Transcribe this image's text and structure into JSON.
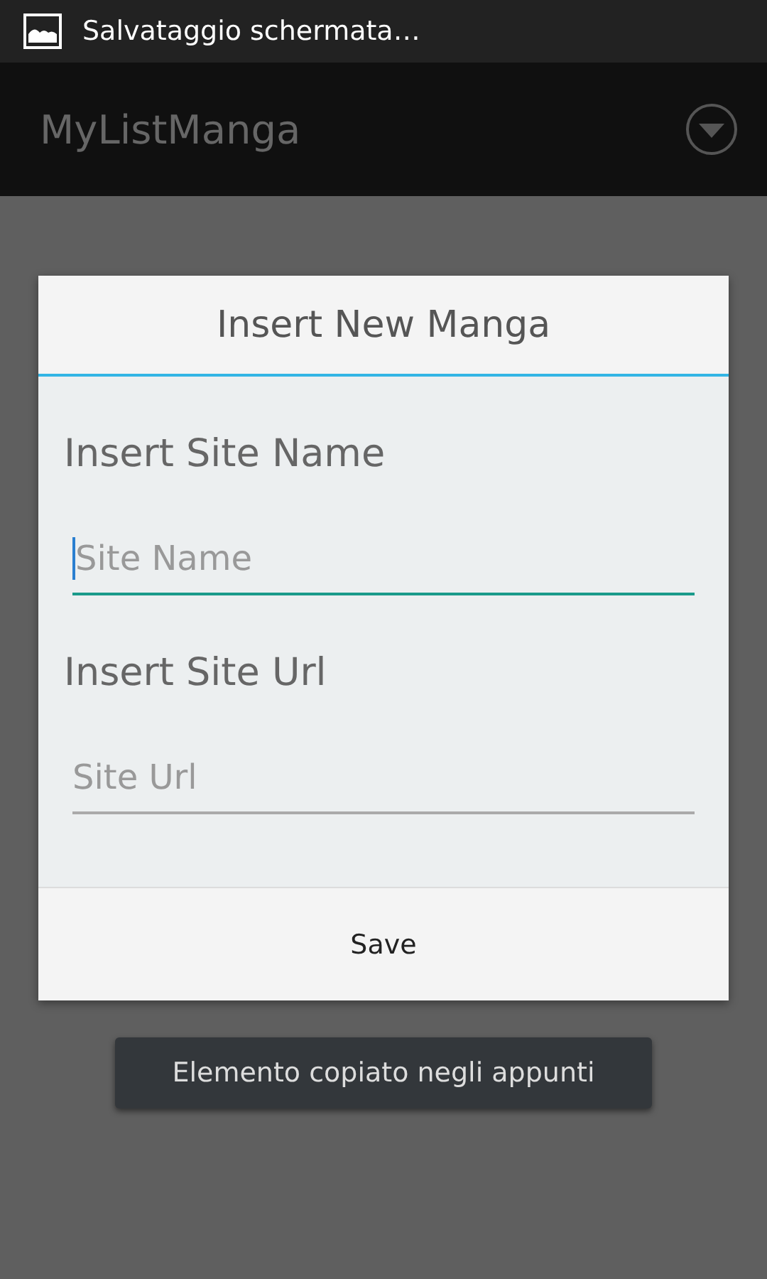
{
  "status_bar": {
    "notification": "Salvataggio schermata…"
  },
  "action_bar": {
    "title": "MyListManga"
  },
  "dialog": {
    "title": "Insert New Manga",
    "sections": [
      {
        "label": "Insert Site Name",
        "placeholder": "Site Name",
        "focused": true
      },
      {
        "label": "Insert Site Url",
        "placeholder": "Site Url",
        "focused": false
      }
    ],
    "buttons": [
      "Save"
    ]
  },
  "toast": "Elemento copiato negli appunti"
}
